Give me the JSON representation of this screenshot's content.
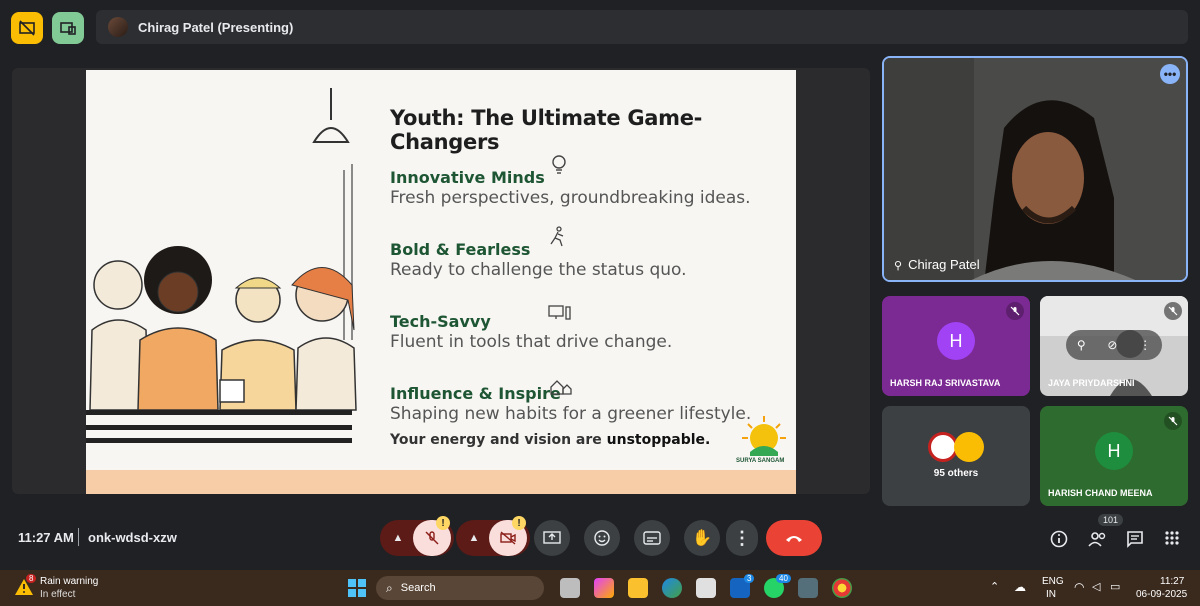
{
  "presenter": {
    "label": "Chirag Patel (Presenting)"
  },
  "slide": {
    "title": "Youth: The Ultimate Game-Changers",
    "points": [
      {
        "heading": "Innovative Minds",
        "text": "Fresh perspectives, groundbreaking ideas."
      },
      {
        "heading": "Bold & Fearless",
        "text": "Ready to challenge the status quo."
      },
      {
        "heading": "Tech-Savvy",
        "text": "Fluent in tools that drive change."
      },
      {
        "heading": "Influence & Inspire",
        "text": "Shaping new habits for a greener lifestyle."
      }
    ],
    "closing_prefix": "Your energy and vision are ",
    "closing_bold": "unstoppable.",
    "logo_text": "SURYA SANGAM"
  },
  "participants": {
    "main": {
      "name": "Chirag Patel"
    },
    "tiles": [
      {
        "name": "HARSH RAJ SRIVASTAVA",
        "initial": "H"
      },
      {
        "name": "JAYA PRIYDARSHNI"
      },
      {
        "others": "95 others"
      },
      {
        "name": "HARISH CHAND MEENA",
        "initial": "H"
      }
    ],
    "count": "101"
  },
  "bottom": {
    "time": "11:27 AM",
    "code": "onk-wdsd-xzw"
  },
  "taskbar": {
    "weather_title": "Rain warning",
    "weather_sub": "In effect",
    "weather_badge": "8",
    "search": "Search",
    "lang1": "ENG",
    "lang2": "IN",
    "clock_time": "11:27",
    "clock_date": "06-09-2025",
    "badge_l": "3",
    "badge_wa": "40"
  },
  "colors": {
    "accent": "#8ab4f8",
    "end_call": "#ea4335",
    "slide_heading": "#1e5634"
  }
}
